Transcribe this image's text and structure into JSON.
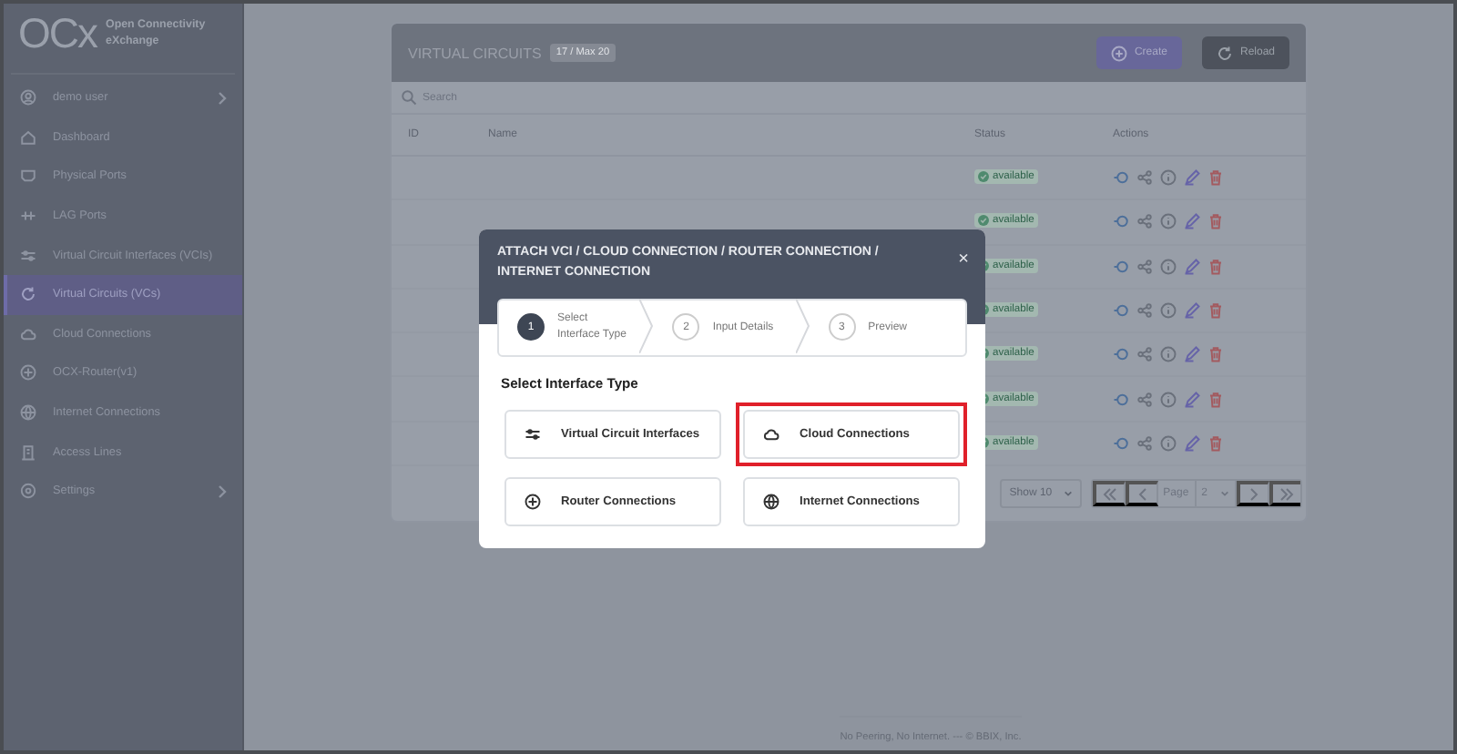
{
  "brand": {
    "logo": "OCx",
    "name_line1": "Open Connectivity",
    "name_line2": "eXchange"
  },
  "sidebar": {
    "items": [
      {
        "label": "demo user",
        "has_submenu": true,
        "selected": false
      },
      {
        "label": "Dashboard",
        "has_submenu": false,
        "selected": false
      },
      {
        "label": "Physical Ports",
        "has_submenu": false,
        "selected": false
      },
      {
        "label": "LAG Ports",
        "has_submenu": false,
        "selected": false
      },
      {
        "label": "Virtual Circuit Interfaces (VCIs)",
        "has_submenu": false,
        "selected": false
      },
      {
        "label": "Virtual Circuits (VCs)",
        "has_submenu": false,
        "selected": true
      },
      {
        "label": "Cloud Connections",
        "has_submenu": false,
        "selected": false
      },
      {
        "label": "OCX-Router(v1)",
        "has_submenu": false,
        "selected": false
      },
      {
        "label": "Internet Connections",
        "has_submenu": false,
        "selected": false
      },
      {
        "label": "Access Lines",
        "has_submenu": false,
        "selected": false
      },
      {
        "label": "Settings",
        "has_submenu": true,
        "selected": false
      }
    ]
  },
  "card": {
    "title": "VIRTUAL CIRCUITS",
    "count_badge": "17 / Max 20",
    "buttons": [
      "Create",
      "Reload"
    ],
    "search": {
      "placeholder": "Search"
    },
    "columns": [
      "ID",
      "Name",
      "Status",
      "Actions"
    ],
    "rows": [
      {
        "status": "available"
      },
      {
        "status": "available"
      },
      {
        "status": "available"
      },
      {
        "status": "available"
      },
      {
        "status": "available"
      },
      {
        "status": "available"
      },
      {
        "status": "available"
      }
    ],
    "pagination": {
      "page_size": "Show 10",
      "page_label": "Page",
      "page": "2"
    }
  },
  "modal": {
    "title": "ATTACH VCI / CLOUD CONNECTION / ROUTER CONNECTION / INTERNET CONNECTION",
    "close": "×",
    "steps": [
      {
        "number": "1",
        "label": "Select Interface Type",
        "selected": true
      },
      {
        "number": "2",
        "label": "Input Details",
        "selected": false
      },
      {
        "number": "3",
        "label": "Preview",
        "selected": false
      }
    ],
    "section_title": "Select Interface Type",
    "options": [
      {
        "label": "Virtual Circuit Interfaces",
        "highlighted": false
      },
      {
        "label": "Cloud Connections",
        "highlighted": true
      },
      {
        "label": "Router Connections",
        "highlighted": false
      },
      {
        "label": "Internet Connections",
        "highlighted": false
      }
    ]
  },
  "footer": "No Peering, No Internet. --- © BBIX, Inc."
}
